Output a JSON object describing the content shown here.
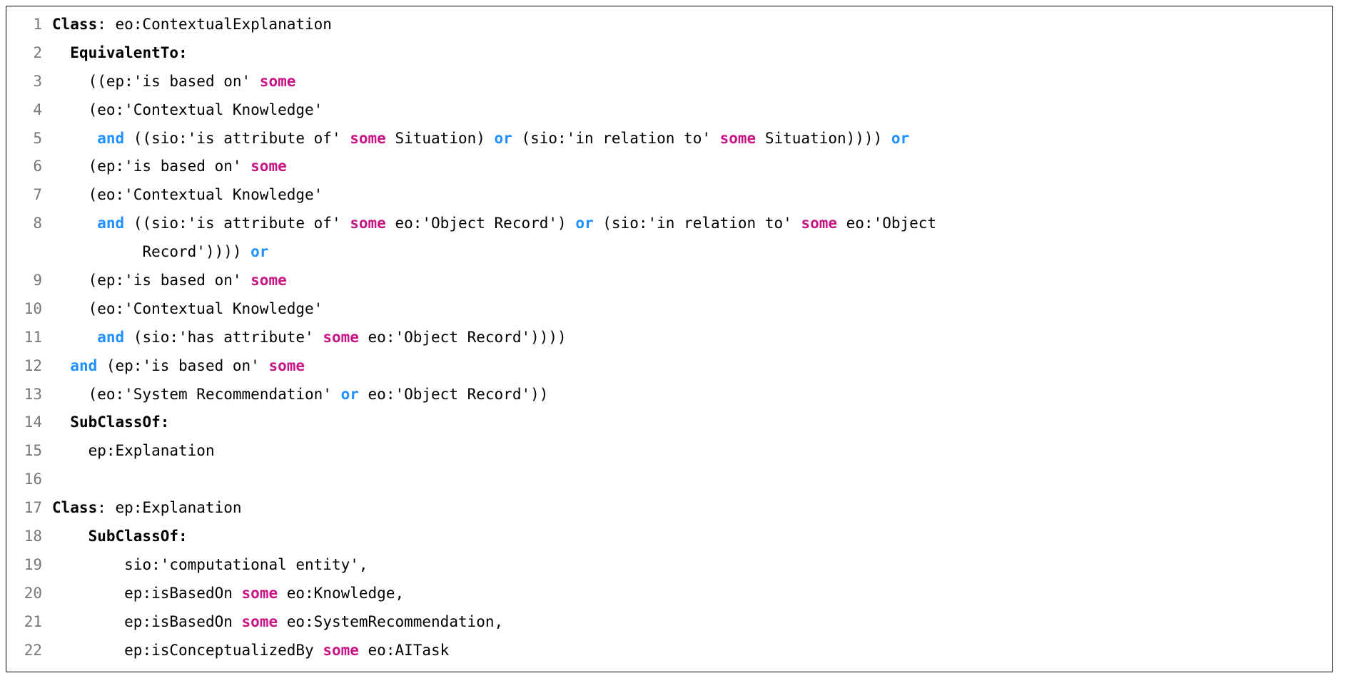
{
  "lines": [
    {
      "n": 1,
      "indent": 0,
      "tokens": [
        {
          "t": "bold",
          "v": "Class"
        },
        {
          "t": "plain",
          "v": ": eo:ContextualExplanation"
        }
      ]
    },
    {
      "n": 2,
      "indent": 2,
      "tokens": [
        {
          "t": "bold",
          "v": "EquivalentTo:"
        }
      ]
    },
    {
      "n": 3,
      "indent": 4,
      "tokens": [
        {
          "t": "plain",
          "v": "((ep:'is based on' "
        },
        {
          "t": "quant",
          "v": "some"
        }
      ]
    },
    {
      "n": 4,
      "indent": 4,
      "tokens": [
        {
          "t": "plain",
          "v": "(eo:'Contextual Knowledge'"
        }
      ]
    },
    {
      "n": 5,
      "indent": 5,
      "tokens": [
        {
          "t": "logic",
          "v": "and"
        },
        {
          "t": "plain",
          "v": " ((sio:'is attribute of' "
        },
        {
          "t": "quant",
          "v": "some"
        },
        {
          "t": "plain",
          "v": " Situation) "
        },
        {
          "t": "logic",
          "v": "or"
        },
        {
          "t": "plain",
          "v": " (sio:'in relation to' "
        },
        {
          "t": "quant",
          "v": "some"
        },
        {
          "t": "plain",
          "v": " Situation)))) "
        },
        {
          "t": "logic",
          "v": "or"
        }
      ]
    },
    {
      "n": 6,
      "indent": 4,
      "tokens": [
        {
          "t": "plain",
          "v": "(ep:'is based on' "
        },
        {
          "t": "quant",
          "v": "some"
        }
      ]
    },
    {
      "n": 7,
      "indent": 4,
      "tokens": [
        {
          "t": "plain",
          "v": "(eo:'Contextual Knowledge'"
        }
      ]
    },
    {
      "n": 8,
      "indent": 5,
      "tokens": [
        {
          "t": "logic",
          "v": "and"
        },
        {
          "t": "plain",
          "v": " ((sio:'is attribute of' "
        },
        {
          "t": "quant",
          "v": "some"
        },
        {
          "t": "plain",
          "v": " eo:'Object Record') "
        },
        {
          "t": "logic",
          "v": "or"
        },
        {
          "t": "plain",
          "v": " (sio:'in relation to' "
        },
        {
          "t": "quant",
          "v": "some"
        },
        {
          "t": "plain",
          "v": " eo:'Object"
        }
      ]
    },
    {
      "n": "8b",
      "indent": 10,
      "tokens": [
        {
          "t": "plain",
          "v": "Record')))) "
        },
        {
          "t": "logic",
          "v": "or"
        }
      ]
    },
    {
      "n": 9,
      "indent": 4,
      "tokens": [
        {
          "t": "plain",
          "v": "(ep:'is based on' "
        },
        {
          "t": "quant",
          "v": "some"
        }
      ]
    },
    {
      "n": 10,
      "indent": 4,
      "tokens": [
        {
          "t": "plain",
          "v": "(eo:'Contextual Knowledge'"
        }
      ]
    },
    {
      "n": 11,
      "indent": 5,
      "tokens": [
        {
          "t": "logic",
          "v": "and"
        },
        {
          "t": "plain",
          "v": " (sio:'has attribute' "
        },
        {
          "t": "quant",
          "v": "some"
        },
        {
          "t": "plain",
          "v": " eo:'Object Record'))))"
        }
      ]
    },
    {
      "n": 12,
      "indent": 2,
      "tokens": [
        {
          "t": "logic",
          "v": "and"
        },
        {
          "t": "plain",
          "v": " (ep:'is based on' "
        },
        {
          "t": "quant",
          "v": "some"
        }
      ]
    },
    {
      "n": 13,
      "indent": 4,
      "tokens": [
        {
          "t": "plain",
          "v": "(eo:'System Recommendation' "
        },
        {
          "t": "logic",
          "v": "or"
        },
        {
          "t": "plain",
          "v": " eo:'Object Record'))"
        }
      ]
    },
    {
      "n": 14,
      "indent": 2,
      "tokens": [
        {
          "t": "bold",
          "v": "SubClassOf:"
        }
      ]
    },
    {
      "n": 15,
      "indent": 4,
      "tokens": [
        {
          "t": "plain",
          "v": "ep:Explanation"
        }
      ]
    },
    {
      "n": 16,
      "indent": 0,
      "tokens": [
        {
          "t": "plain",
          "v": ""
        }
      ]
    },
    {
      "n": 17,
      "indent": 0,
      "tokens": [
        {
          "t": "bold",
          "v": "Class"
        },
        {
          "t": "plain",
          "v": ": ep:Explanation"
        }
      ]
    },
    {
      "n": 18,
      "indent": 4,
      "tokens": [
        {
          "t": "bold",
          "v": "SubClassOf:"
        }
      ]
    },
    {
      "n": 19,
      "indent": 8,
      "tokens": [
        {
          "t": "plain",
          "v": "sio:'computational entity',"
        }
      ]
    },
    {
      "n": 20,
      "indent": 8,
      "tokens": [
        {
          "t": "plain",
          "v": "ep:isBasedOn "
        },
        {
          "t": "quant",
          "v": "some"
        },
        {
          "t": "plain",
          "v": " eo:Knowledge,"
        }
      ]
    },
    {
      "n": 21,
      "indent": 8,
      "tokens": [
        {
          "t": "plain",
          "v": "ep:isBasedOn "
        },
        {
          "t": "quant",
          "v": "some"
        },
        {
          "t": "plain",
          "v": " eo:SystemRecommendation,"
        }
      ]
    },
    {
      "n": 22,
      "indent": 8,
      "tokens": [
        {
          "t": "plain",
          "v": "ep:isConceptualizedBy "
        },
        {
          "t": "quant",
          "v": "some"
        },
        {
          "t": "plain",
          "v": " eo:AITask"
        }
      ]
    }
  ]
}
